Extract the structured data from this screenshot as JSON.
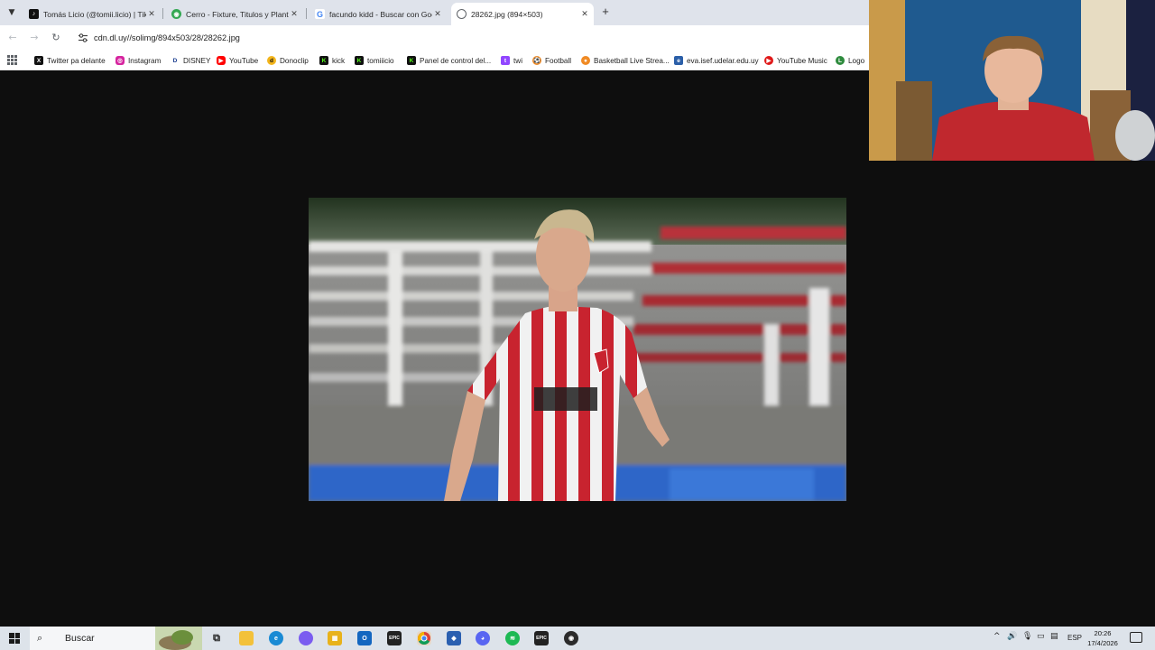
{
  "browser": {
    "tabs": [
      {
        "title": "Tomás Licio (@tomii.licio) | TikTok",
        "icon": "tiktok-icon",
        "active": false
      },
      {
        "title": "Cerro - Fixture, Titulos y Plantel",
        "icon": "globe-icon",
        "active": false
      },
      {
        "title": "facundo kidd - Buscar con Google",
        "icon": "google-icon",
        "active": false
      },
      {
        "title": "28262.jpg (894×503)",
        "icon": "globe-icon",
        "active": true
      }
    ],
    "url": "cdn.dl.uy//solimg/894x503/28/28262.jpg",
    "bookmarks": [
      {
        "label": "Twitter pa delante",
        "icon": "x-icon"
      },
      {
        "label": "Instagram",
        "icon": "instagram-icon"
      },
      {
        "label": "DISNEY",
        "icon": "disney-icon"
      },
      {
        "label": "YouTube",
        "icon": "youtube-icon"
      },
      {
        "label": "Donoclip",
        "icon": "donoclip-icon"
      },
      {
        "label": "kick",
        "icon": "kick-icon"
      },
      {
        "label": "tomiiicio",
        "icon": "kick-icon"
      },
      {
        "label": "Panel de control del...",
        "icon": "kick-icon"
      },
      {
        "label": "twi",
        "icon": "twitch-icon"
      },
      {
        "label": "Football",
        "icon": "football-icon"
      },
      {
        "label": "Basketball Live Strea...",
        "icon": "basketball-icon"
      },
      {
        "label": "eva.isef.udelar.edu.uy",
        "icon": "eva-icon"
      },
      {
        "label": "YouTube Music",
        "icon": "youtube-music-icon"
      },
      {
        "label": "Logo",
        "icon": "logo-icon"
      }
    ]
  },
  "taskbar": {
    "search_label": "Buscar",
    "apps": [
      "task-view-icon",
      "file-explorer-icon",
      "edge-icon",
      "copilot-icon",
      "store-icon",
      "outlook-icon",
      "epic-games-icon",
      "chrome-icon",
      "shield-app-icon",
      "discord-icon",
      "spotify-icon",
      "epic-games-icon",
      "obs-icon"
    ],
    "language": "ESP",
    "time": "20:26",
    "date": "17/4/2026"
  },
  "colors": {
    "page_background": "#0e0e0e",
    "tabbar": "#dfe3eb",
    "taskbar": "#dde3ea"
  }
}
